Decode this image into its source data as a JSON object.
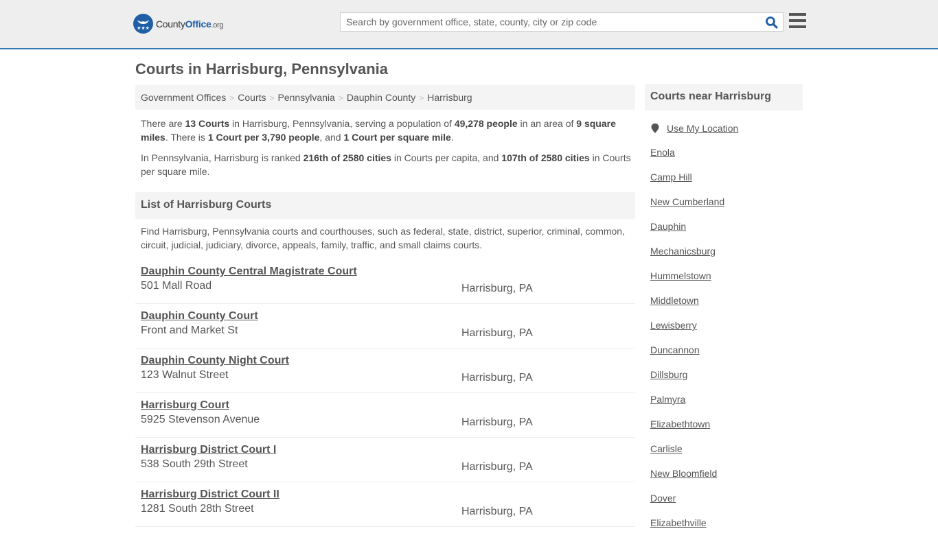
{
  "header": {
    "logo": {
      "name": "County",
      "name_bold": "Office",
      "tld": ".org"
    },
    "search": {
      "placeholder": "Search by government office, state, county, city or zip code",
      "value": ""
    },
    "icons": {
      "search": "search-icon",
      "menu": "hamburger-menu-icon"
    }
  },
  "page": {
    "title": "Courts in Harrisburg, Pennsylvania",
    "breadcrumb": [
      "Government Offices",
      "Courts",
      "Pennsylvania",
      "Dauphin County",
      "Harrisburg"
    ],
    "breadcrumb_separator": ">",
    "intro": {
      "p1": {
        "t1": "There are ",
        "b1": "13 Courts",
        "t2": " in Harrisburg, Pennsylvania, serving a population of ",
        "b2": "49,278 people",
        "t3": " in an area of ",
        "b3": "9 square miles",
        "t4": ". There is ",
        "b4": "1 Court per 3,790 people",
        "t5": ", and ",
        "b5": "1 Court per square mile",
        "t6": "."
      },
      "p2": {
        "t1": "In Pennsylvania, Harrisburg is ranked ",
        "b1": "216th of 2580 cities",
        "t2": " in Courts per capita, and ",
        "b2": "107th of 2580 cities",
        "t3": " in Courts per square mile."
      }
    },
    "list_heading": "List of Harrisburg Courts",
    "list_description": "Find Harrisburg, Pennsylvania courts and courthouses, such as federal, state, district, superior, criminal, common, circuit, judicial, judiciary, divorce, appeals, family, traffic, and small claims courts.",
    "courts": [
      {
        "name": "Dauphin County Central Magistrate Court",
        "address": "501 Mall Road",
        "city": "Harrisburg, PA"
      },
      {
        "name": "Dauphin County Court",
        "address": "Front and Market St",
        "city": "Harrisburg, PA"
      },
      {
        "name": "Dauphin County Night Court",
        "address": "123 Walnut Street",
        "city": "Harrisburg, PA"
      },
      {
        "name": "Harrisburg Court",
        "address": "5925 Stevenson Avenue",
        "city": "Harrisburg, PA"
      },
      {
        "name": "Harrisburg District Court I",
        "address": "538 South 29th Street",
        "city": "Harrisburg, PA"
      },
      {
        "name": "Harrisburg District Court II",
        "address": "1281 South 28th Street",
        "city": "Harrisburg, PA"
      }
    ]
  },
  "sidebar": {
    "heading": "Courts near Harrisburg",
    "use_location": "Use My Location",
    "nearby": [
      "Enola",
      "Camp Hill",
      "New Cumberland",
      "Dauphin",
      "Mechanicsburg",
      "Hummelstown",
      "Middletown",
      "Lewisberry",
      "Duncannon",
      "Dillsburg",
      "Palmyra",
      "Elizabethtown",
      "Carlisle",
      "New Bloomfield",
      "Dover",
      "Elizabethville"
    ]
  },
  "colors": {
    "brand": "#1f5fa6",
    "accent_border": "#337ab7",
    "text": "#555555",
    "panel_bg": "#f4f4f4",
    "header_bg": "#eeeeee"
  }
}
